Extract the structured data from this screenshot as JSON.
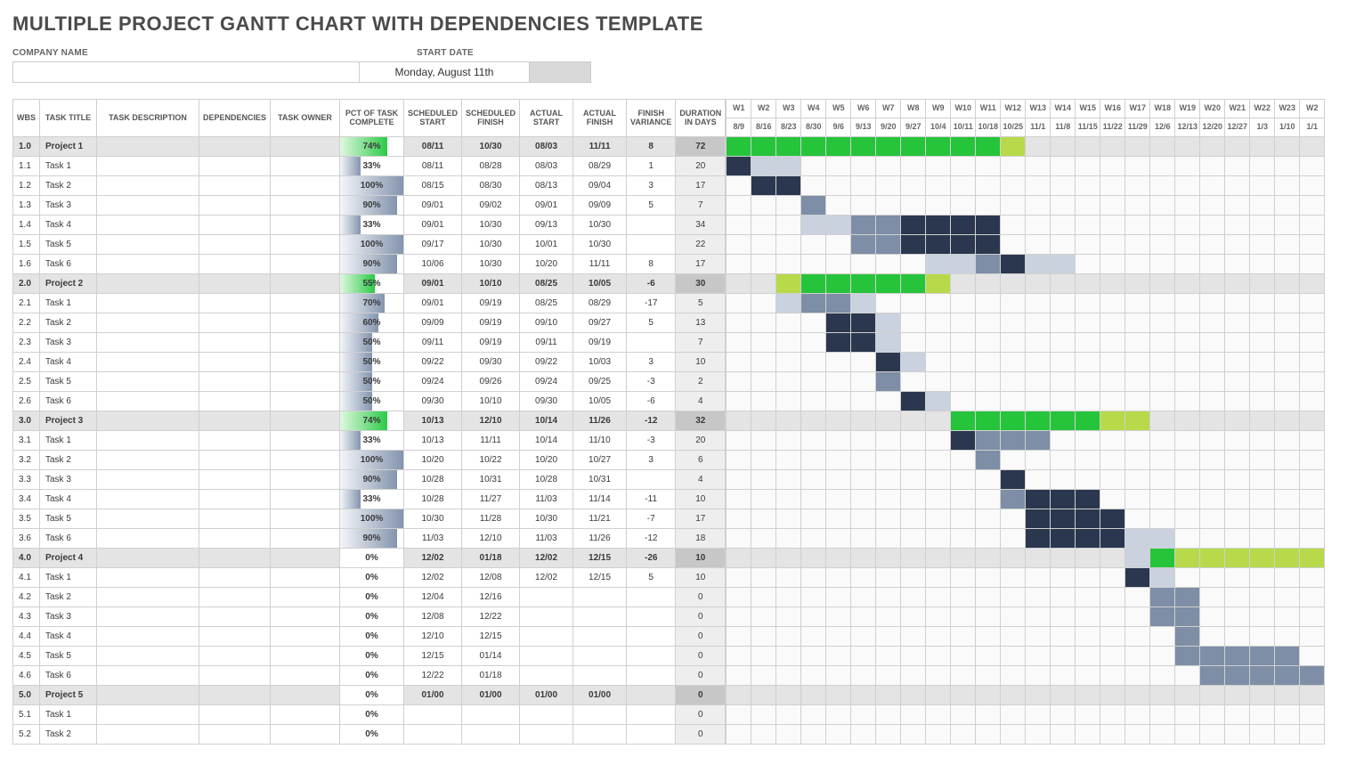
{
  "title": "MULTIPLE PROJECT GANTT CHART WITH DEPENDENCIES TEMPLATE",
  "meta": {
    "company_label": "COMPANY NAME",
    "company_value": "",
    "start_label": "START DATE",
    "start_value": "Monday, August 11th"
  },
  "columns": [
    "WBS",
    "TASK TITLE",
    "TASK DESCRIPTION",
    "DEPENDENCIES",
    "TASK OWNER",
    "PCT OF TASK COMPLETE",
    "SCHEDULED START",
    "SCHEDULED FINISH",
    "ACTUAL START",
    "ACTUAL FINISH",
    "FINISH VARIANCE",
    "DURATION IN DAYS"
  ],
  "weeks": [
    "W1",
    "W2",
    "W3",
    "W4",
    "W5",
    "W6",
    "W7",
    "W8",
    "W9",
    "W10",
    "W11",
    "W12",
    "W13",
    "W14",
    "W15",
    "W16",
    "W17",
    "W18",
    "W19",
    "W20",
    "W21",
    "W22",
    "W23",
    "W2"
  ],
  "dates": [
    "8/9",
    "8/16",
    "8/23",
    "8/30",
    "9/6",
    "9/13",
    "9/20",
    "9/27",
    "10/4",
    "10/11",
    "10/18",
    "10/25",
    "11/1",
    "11/8",
    "11/15",
    "11/22",
    "11/29",
    "12/6",
    "12/13",
    "12/20",
    "12/27",
    "1/3",
    "1/10",
    "1/1"
  ],
  "chart_data": {
    "type": "gantt",
    "x_units": "weeks",
    "x_range": [
      "8/9",
      "1/1+"
    ],
    "rows": [
      {
        "wbs": "1.0",
        "title": "Project 1",
        "kind": "project",
        "pct": 74,
        "sch_start": "08/11",
        "sch_fin": "10/30",
        "act_start": "08/03",
        "act_fin": "11/11",
        "var": 8,
        "dur": 72,
        "bars": [
          {
            "from": 0,
            "to": 11,
            "type": "done-proj"
          },
          {
            "from": 11,
            "to": 12,
            "type": "rem-proj"
          }
        ]
      },
      {
        "wbs": "1.1",
        "title": "Task 1",
        "kind": "task",
        "pct": 33,
        "sch_start": "08/11",
        "sch_fin": "08/28",
        "act_start": "08/03",
        "act_fin": "08/29",
        "var": 1,
        "dur": 20,
        "bars": [
          {
            "from": 0,
            "to": 1,
            "type": "done-task"
          },
          {
            "from": 1,
            "to": 3,
            "type": "rem-task"
          }
        ]
      },
      {
        "wbs": "1.2",
        "title": "Task 2",
        "kind": "task",
        "pct": 100,
        "sch_start": "08/15",
        "sch_fin": "08/30",
        "act_start": "08/13",
        "act_fin": "09/04",
        "var": 3,
        "dur": 17,
        "bars": [
          {
            "from": 1,
            "to": 3,
            "type": "done-task"
          }
        ]
      },
      {
        "wbs": "1.3",
        "title": "Task 3",
        "kind": "task",
        "pct": 90,
        "sch_start": "09/01",
        "sch_fin": "09/02",
        "act_start": "09/01",
        "act_fin": "09/09",
        "var": 5,
        "dur": 7,
        "bars": [
          {
            "from": 3,
            "to": 4,
            "type": "mid-task"
          }
        ]
      },
      {
        "wbs": "1.4",
        "title": "Task 4",
        "kind": "task",
        "pct": 33,
        "sch_start": "09/01",
        "sch_fin": "10/30",
        "act_start": "09/13",
        "act_fin": "10/30",
        "var": "",
        "dur": 34,
        "bars": [
          {
            "from": 3,
            "to": 5,
            "type": "rem-task"
          },
          {
            "from": 5,
            "to": 7,
            "type": "mid-task"
          },
          {
            "from": 7,
            "to": 11,
            "type": "done-task"
          }
        ]
      },
      {
        "wbs": "1.5",
        "title": "Task 5",
        "kind": "task",
        "pct": 100,
        "sch_start": "09/17",
        "sch_fin": "10/30",
        "act_start": "10/01",
        "act_fin": "10/30",
        "var": "",
        "dur": 22,
        "bars": [
          {
            "from": 5,
            "to": 7,
            "type": "mid-task"
          },
          {
            "from": 7,
            "to": 11,
            "type": "done-task"
          }
        ]
      },
      {
        "wbs": "1.6",
        "title": "Task 6",
        "kind": "task",
        "pct": 90,
        "sch_start": "10/06",
        "sch_fin": "10/30",
        "act_start": "10/20",
        "act_fin": "11/11",
        "var": 8,
        "dur": 17,
        "bars": [
          {
            "from": 8,
            "to": 10,
            "type": "rem-task"
          },
          {
            "from": 10,
            "to": 11,
            "type": "mid-task"
          },
          {
            "from": 11,
            "to": 12,
            "type": "done-task"
          },
          {
            "from": 12,
            "to": 14,
            "type": "rem-task"
          }
        ]
      },
      {
        "wbs": "2.0",
        "title": "Project 2",
        "kind": "project",
        "pct": 55,
        "sch_start": "09/01",
        "sch_fin": "10/10",
        "act_start": "08/25",
        "act_fin": "10/05",
        "var": -6,
        "dur": 30,
        "bars": [
          {
            "from": 2,
            "to": 3,
            "type": "rem-proj"
          },
          {
            "from": 3,
            "to": 8,
            "type": "done-proj"
          },
          {
            "from": 8,
            "to": 9,
            "type": "rem-proj"
          }
        ]
      },
      {
        "wbs": "2.1",
        "title": "Task 1",
        "kind": "task",
        "pct": 70,
        "sch_start": "09/01",
        "sch_fin": "09/19",
        "act_start": "08/25",
        "act_fin": "08/29",
        "var": -17,
        "dur": 5,
        "bars": [
          {
            "from": 2,
            "to": 3,
            "type": "rem-task"
          },
          {
            "from": 3,
            "to": 5,
            "type": "mid-task"
          },
          {
            "from": 5,
            "to": 6,
            "type": "rem-task"
          }
        ]
      },
      {
        "wbs": "2.2",
        "title": "Task 2",
        "kind": "task",
        "pct": 60,
        "sch_start": "09/09",
        "sch_fin": "09/19",
        "act_start": "09/10",
        "act_fin": "09/27",
        "var": 5,
        "dur": 13,
        "bars": [
          {
            "from": 4,
            "to": 6,
            "type": "done-task"
          },
          {
            "from": 6,
            "to": 7,
            "type": "rem-task"
          }
        ]
      },
      {
        "wbs": "2.3",
        "title": "Task 3",
        "kind": "task",
        "pct": 50,
        "sch_start": "09/11",
        "sch_fin": "09/19",
        "act_start": "09/11",
        "act_fin": "09/19",
        "var": "",
        "dur": 7,
        "bars": [
          {
            "from": 4,
            "to": 6,
            "type": "done-task"
          },
          {
            "from": 6,
            "to": 7,
            "type": "rem-task"
          }
        ]
      },
      {
        "wbs": "2.4",
        "title": "Task 4",
        "kind": "task",
        "pct": 50,
        "sch_start": "09/22",
        "sch_fin": "09/30",
        "act_start": "09/22",
        "act_fin": "10/03",
        "var": 3,
        "dur": 10,
        "bars": [
          {
            "from": 6,
            "to": 7,
            "type": "done-task"
          },
          {
            "from": 7,
            "to": 8,
            "type": "rem-task"
          }
        ]
      },
      {
        "wbs": "2.5",
        "title": "Task 5",
        "kind": "task",
        "pct": 50,
        "sch_start": "09/24",
        "sch_fin": "09/26",
        "act_start": "09/24",
        "act_fin": "09/25",
        "var": -3,
        "dur": 2,
        "bars": [
          {
            "from": 6,
            "to": 7,
            "type": "mid-task"
          }
        ]
      },
      {
        "wbs": "2.6",
        "title": "Task 6",
        "kind": "task",
        "pct": 50,
        "sch_start": "09/30",
        "sch_fin": "10/10",
        "act_start": "09/30",
        "act_fin": "10/05",
        "var": -6,
        "dur": 4,
        "bars": [
          {
            "from": 7,
            "to": 8,
            "type": "done-task"
          },
          {
            "from": 8,
            "to": 9,
            "type": "rem-task"
          }
        ]
      },
      {
        "wbs": "3.0",
        "title": "Project 3",
        "kind": "project",
        "pct": 74,
        "sch_start": "10/13",
        "sch_fin": "12/10",
        "act_start": "10/14",
        "act_fin": "11/26",
        "var": -12,
        "dur": 32,
        "bars": [
          {
            "from": 9,
            "to": 15,
            "type": "done-proj"
          },
          {
            "from": 15,
            "to": 17,
            "type": "rem-proj"
          }
        ]
      },
      {
        "wbs": "3.1",
        "title": "Task 1",
        "kind": "task",
        "pct": 33,
        "sch_start": "10/13",
        "sch_fin": "11/11",
        "act_start": "10/14",
        "act_fin": "11/10",
        "var": -3,
        "dur": 20,
        "bars": [
          {
            "from": 9,
            "to": 10,
            "type": "done-task"
          },
          {
            "from": 10,
            "to": 13,
            "type": "mid-task"
          }
        ]
      },
      {
        "wbs": "3.2",
        "title": "Task 2",
        "kind": "task",
        "pct": 100,
        "sch_start": "10/20",
        "sch_fin": "10/22",
        "act_start": "10/20",
        "act_fin": "10/27",
        "var": 3,
        "dur": 6,
        "bars": [
          {
            "from": 10,
            "to": 11,
            "type": "mid-task"
          }
        ]
      },
      {
        "wbs": "3.3",
        "title": "Task 3",
        "kind": "task",
        "pct": 90,
        "sch_start": "10/28",
        "sch_fin": "10/31",
        "act_start": "10/28",
        "act_fin": "10/31",
        "var": "",
        "dur": 4,
        "bars": [
          {
            "from": 11,
            "to": 12,
            "type": "done-task"
          }
        ]
      },
      {
        "wbs": "3.4",
        "title": "Task 4",
        "kind": "task",
        "pct": 33,
        "sch_start": "10/28",
        "sch_fin": "11/27",
        "act_start": "11/03",
        "act_fin": "11/14",
        "var": -11,
        "dur": 10,
        "bars": [
          {
            "from": 11,
            "to": 12,
            "type": "mid-task"
          },
          {
            "from": 12,
            "to": 15,
            "type": "done-task"
          }
        ]
      },
      {
        "wbs": "3.5",
        "title": "Task 5",
        "kind": "task",
        "pct": 100,
        "sch_start": "10/30",
        "sch_fin": "11/28",
        "act_start": "10/30",
        "act_fin": "11/21",
        "var": -7,
        "dur": 17,
        "bars": [
          {
            "from": 12,
            "to": 16,
            "type": "done-task"
          }
        ]
      },
      {
        "wbs": "3.6",
        "title": "Task 6",
        "kind": "task",
        "pct": 90,
        "sch_start": "11/03",
        "sch_fin": "12/10",
        "act_start": "11/03",
        "act_fin": "11/26",
        "var": -12,
        "dur": 18,
        "bars": [
          {
            "from": 12,
            "to": 16,
            "type": "done-task"
          },
          {
            "from": 16,
            "to": 18,
            "type": "rem-task"
          }
        ]
      },
      {
        "wbs": "4.0",
        "title": "Project 4",
        "kind": "project",
        "pct": 0,
        "sch_start": "12/02",
        "sch_fin": "01/18",
        "act_start": "12/02",
        "act_fin": "12/15",
        "var": -26,
        "dur": 10,
        "bars": [
          {
            "from": 16,
            "to": 17,
            "type": "rem-task"
          },
          {
            "from": 17,
            "to": 18,
            "type": "done-proj"
          },
          {
            "from": 18,
            "to": 24,
            "type": "rem-proj"
          }
        ]
      },
      {
        "wbs": "4.1",
        "title": "Task 1",
        "kind": "task",
        "pct": 0,
        "sch_start": "12/02",
        "sch_fin": "12/08",
        "act_start": "12/02",
        "act_fin": "12/15",
        "var": 5,
        "dur": 10,
        "bars": [
          {
            "from": 16,
            "to": 17,
            "type": "done-task"
          },
          {
            "from": 17,
            "to": 18,
            "type": "rem-task"
          }
        ]
      },
      {
        "wbs": "4.2",
        "title": "Task 2",
        "kind": "task",
        "pct": 0,
        "sch_start": "12/04",
        "sch_fin": "12/16",
        "act_start": "",
        "act_fin": "",
        "var": "",
        "dur": 0,
        "bars": [
          {
            "from": 17,
            "to": 19,
            "type": "mid-task"
          }
        ]
      },
      {
        "wbs": "4.3",
        "title": "Task 3",
        "kind": "task",
        "pct": 0,
        "sch_start": "12/08",
        "sch_fin": "12/22",
        "act_start": "",
        "act_fin": "",
        "var": "",
        "dur": 0,
        "bars": [
          {
            "from": 17,
            "to": 19,
            "type": "mid-task"
          }
        ]
      },
      {
        "wbs": "4.4",
        "title": "Task 4",
        "kind": "task",
        "pct": 0,
        "sch_start": "12/10",
        "sch_fin": "12/15",
        "act_start": "",
        "act_fin": "",
        "var": "",
        "dur": 0,
        "bars": [
          {
            "from": 18,
            "to": 19,
            "type": "mid-task"
          }
        ]
      },
      {
        "wbs": "4.5",
        "title": "Task 5",
        "kind": "task",
        "pct": 0,
        "sch_start": "12/15",
        "sch_fin": "01/14",
        "act_start": "",
        "act_fin": "",
        "var": "",
        "dur": 0,
        "bars": [
          {
            "from": 18,
            "to": 23,
            "type": "mid-task"
          }
        ]
      },
      {
        "wbs": "4.6",
        "title": "Task 6",
        "kind": "task",
        "pct": 0,
        "sch_start": "12/22",
        "sch_fin": "01/18",
        "act_start": "",
        "act_fin": "",
        "var": "",
        "dur": 0,
        "bars": [
          {
            "from": 19,
            "to": 24,
            "type": "mid-task"
          }
        ]
      },
      {
        "wbs": "5.0",
        "title": "Project 5",
        "kind": "project",
        "pct": 0,
        "sch_start": "01/00",
        "sch_fin": "01/00",
        "act_start": "01/00",
        "act_fin": "01/00",
        "var": "",
        "dur": 0,
        "bars": []
      },
      {
        "wbs": "5.1",
        "title": "Task 1",
        "kind": "task",
        "pct": 0,
        "sch_start": "",
        "sch_fin": "",
        "act_start": "",
        "act_fin": "",
        "var": "",
        "dur": 0,
        "bars": []
      },
      {
        "wbs": "5.2",
        "title": "Task 2",
        "kind": "task",
        "pct": 0,
        "sch_start": "",
        "sch_fin": "",
        "act_start": "",
        "act_fin": "",
        "var": "",
        "dur": 0,
        "bars": []
      }
    ]
  }
}
